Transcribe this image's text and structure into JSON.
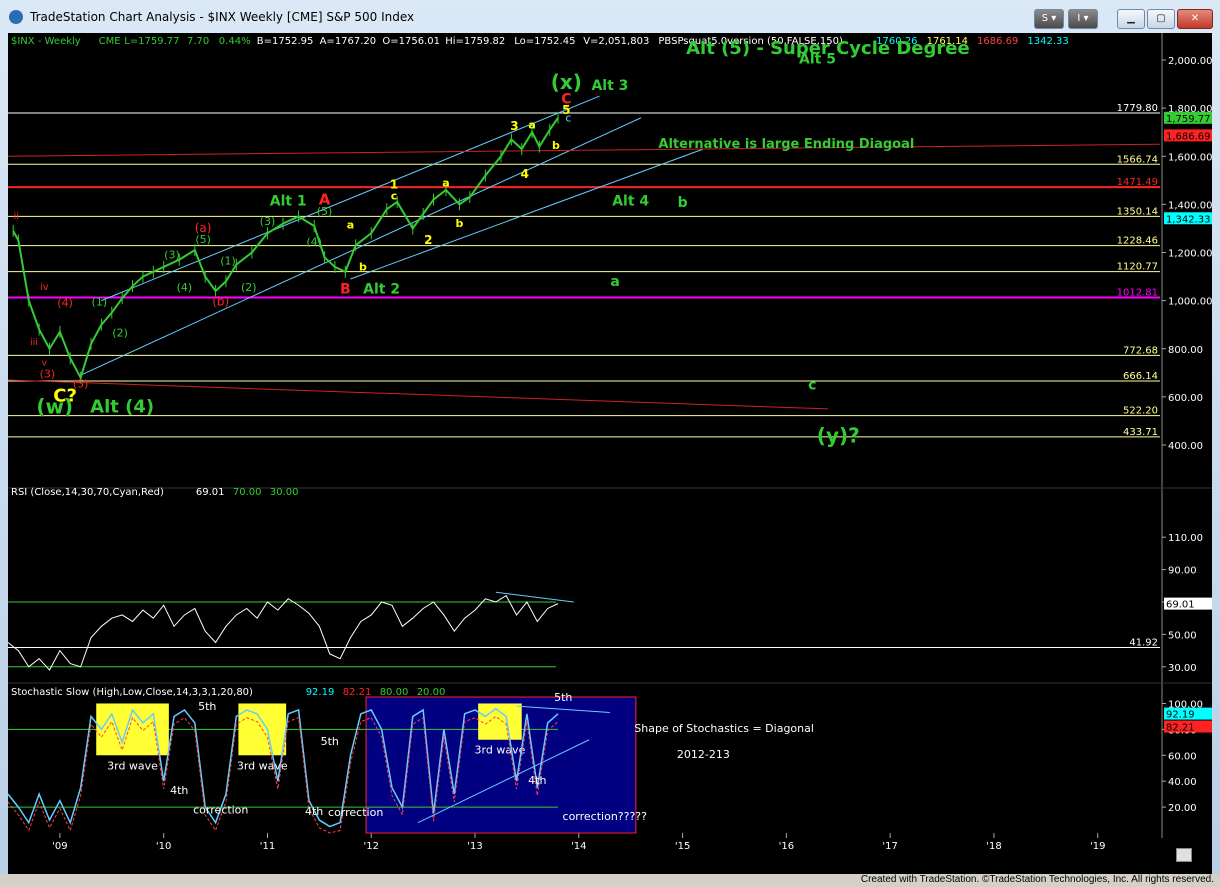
{
  "window": {
    "title": "TradeStation Chart Analysis - $INX Weekly [CME] S&P 500 Index",
    "buttons": {
      "s_label": "S",
      "i_label": "I"
    }
  },
  "header": {
    "symbol": "$INX - Weekly",
    "exchange": "CME",
    "last": "L=1759.77",
    "change": "7.70",
    "pct": "0.44%",
    "bid": "B=1752.95",
    "ask": "A=1767.20",
    "open": "O=1756.01",
    "hi": "Hi=1759.82",
    "lo": "Lo=1752.45",
    "vol": "V=2,051,803",
    "study": "PBSPsquat5.0version (50,FALSE,150)",
    "study_vals": [
      "1760.26",
      "1761.14",
      "1686.69",
      "1342.33"
    ],
    "study_colors": [
      "#00ffff",
      "#ffff66",
      "#ff4040",
      "#00ffff"
    ]
  },
  "colors": {
    "up": "#33cc33",
    "level_yellow": "#ffff99",
    "level_red": "#ff2222",
    "level_magenta": "#ff00ff",
    "trend_cyan": "#66ccff",
    "count_green": "#33cc33",
    "count_red": "#ff2222",
    "count_yellow": "#ffff00",
    "stoch_panel": "#000080",
    "stoch_box": "#ffff33"
  },
  "chart_data": {
    "type": "line",
    "xlabel": "",
    "ylabel": "",
    "x_ticks": [
      "'09",
      "'10",
      "'11",
      "'12",
      "'13",
      "'14",
      "'15",
      "'16",
      "'17",
      "'18",
      "'19"
    ],
    "price_ticks": [
      "2,000.00",
      "1,800.00",
      "1,600.00",
      "1,400.00",
      "1,200.00",
      "1,000.00",
      "800.00",
      "600.00",
      "400.00"
    ],
    "ylim": [
      350,
      2150
    ],
    "price_series": {
      "name": "$INX",
      "x": [
        2008.55,
        2008.6,
        2008.7,
        2008.8,
        2008.9,
        2009.0,
        2009.1,
        2009.2,
        2009.3,
        2009.4,
        2009.5,
        2009.6,
        2009.7,
        2009.8,
        2009.9,
        2010.0,
        2010.15,
        2010.3,
        2010.4,
        2010.5,
        2010.6,
        2010.7,
        2010.85,
        2011.0,
        2011.15,
        2011.3,
        2011.45,
        2011.55,
        2011.65,
        2011.75,
        2011.85,
        2012.0,
        2012.15,
        2012.25,
        2012.4,
        2012.5,
        2012.6,
        2012.72,
        2012.85,
        2012.95,
        2013.1,
        2013.25,
        2013.35,
        2013.45,
        2013.55,
        2013.62,
        2013.72,
        2013.8
      ],
      "y": [
        1290,
        1250,
        1000,
        880,
        800,
        870,
        760,
        680,
        820,
        900,
        950,
        1010,
        1060,
        1100,
        1120,
        1140,
        1170,
        1210,
        1100,
        1040,
        1080,
        1150,
        1200,
        1280,
        1320,
        1350,
        1310,
        1180,
        1140,
        1120,
        1230,
        1280,
        1380,
        1410,
        1300,
        1360,
        1420,
        1460,
        1400,
        1430,
        1520,
        1600,
        1670,
        1630,
        1700,
        1640,
        1710,
        1760
      ]
    },
    "levels": [
      {
        "label": "1779.80",
        "value": 1779.8,
        "color": "#ffffff"
      },
      {
        "label": "1566.74",
        "value": 1566.74,
        "color": "#ffff99"
      },
      {
        "label": "1471.49",
        "value": 1471.49,
        "color": "#ff2222"
      },
      {
        "label": "1350.14",
        "value": 1350.14,
        "color": "#ffff99"
      },
      {
        "label": "1228.46",
        "value": 1228.46,
        "color": "#ffff99"
      },
      {
        "label": "1120.77",
        "value": 1120.77,
        "color": "#ffff99"
      },
      {
        "label": "1012.81",
        "value": 1012.81,
        "color": "#ff00ff"
      },
      {
        "label": "772.68",
        "value": 772.68,
        "color": "#ffff99"
      },
      {
        "label": "666.14",
        "value": 666.14,
        "color": "#ffff99"
      },
      {
        "label": "522.20",
        "value": 522.2,
        "color": "#ffff99"
      },
      {
        "label": "433.71",
        "value": 433.71,
        "color": "#ffff99"
      }
    ],
    "price_tags": [
      {
        "label": "1,759.77",
        "value": 1759.77,
        "bg": "#33cc33",
        "fg": "#000000"
      },
      {
        "label": "1,686.69",
        "value": 1686.69,
        "bg": "#ff2222",
        "fg": "#000000"
      },
      {
        "label": "1,342.33",
        "value": 1342.33,
        "bg": "#00ffff",
        "fg": "#000000"
      }
    ],
    "trendlines": [
      {
        "x1": 2009.2,
        "y1": 690,
        "x2": 2014.6,
        "y2": 1760,
        "color": "#66ccff"
      },
      {
        "x1": 2009.4,
        "y1": 1000,
        "x2": 2014.2,
        "y2": 1850,
        "color": "#66ccff"
      },
      {
        "x1": 2011.8,
        "y1": 1090,
        "x2": 2015.2,
        "y2": 1630,
        "color": "#66ccff"
      },
      {
        "x1": 2008.5,
        "y1": 670,
        "x2": 2016.4,
        "y2": 550,
        "color": "#cc2222"
      },
      {
        "x1": 2008.5,
        "y1": 1600,
        "x2": 2019.6,
        "y2": 1650,
        "color": "#cc2222"
      }
    ],
    "annotations": [
      {
        "text": "(x)",
        "x": 2013.88,
        "y": 1880,
        "color": "#33cc33",
        "size": 20,
        "bold": true
      },
      {
        "text": "Alt 3",
        "x": 2014.3,
        "y": 1875,
        "color": "#33cc33",
        "size": 14,
        "bold": true
      },
      {
        "text": "C",
        "x": 2013.88,
        "y": 1820,
        "color": "#ff2222",
        "size": 14,
        "bold": true
      },
      {
        "text": "5",
        "x": 2013.88,
        "y": 1775,
        "color": "#ffff00",
        "size": 12,
        "bold": true
      },
      {
        "text": "c",
        "x": 2013.9,
        "y": 1745,
        "color": "#66ccff",
        "size": 11,
        "bold": false
      },
      {
        "text": "Alt (5) - Super Cycle Degree",
        "x": 2016.4,
        "y": 2025,
        "color": "#33cc33",
        "size": 18,
        "bold": true
      },
      {
        "text": "Alt 5",
        "x": 2016.3,
        "y": 1985,
        "color": "#33cc33",
        "size": 14,
        "bold": true
      },
      {
        "text": "Alternative is large Ending Diagoal",
        "x": 2016.0,
        "y": 1635,
        "color": "#33cc33",
        "size": 13,
        "bold": true
      },
      {
        "text": "3",
        "x": 2013.38,
        "y": 1710,
        "color": "#ffff00",
        "size": 12,
        "bold": true
      },
      {
        "text": "a",
        "x": 2013.55,
        "y": 1715,
        "color": "#ffff00",
        "size": 11,
        "bold": true
      },
      {
        "text": "b",
        "x": 2013.78,
        "y": 1630,
        "color": "#ffff00",
        "size": 11,
        "bold": true
      },
      {
        "text": "4",
        "x": 2013.48,
        "y": 1510,
        "color": "#ffff00",
        "size": 12,
        "bold": true
      },
      {
        "text": "Alt 4",
        "x": 2014.5,
        "y": 1395,
        "color": "#33cc33",
        "size": 14,
        "bold": true
      },
      {
        "text": "b",
        "x": 2015.0,
        "y": 1390,
        "color": "#33cc33",
        "size": 14,
        "bold": true
      },
      {
        "text": "a",
        "x": 2014.35,
        "y": 1060,
        "color": "#33cc33",
        "size": 14,
        "bold": true
      },
      {
        "text": "c",
        "x": 2016.25,
        "y": 630,
        "color": "#33cc33",
        "size": 14,
        "bold": true
      },
      {
        "text": "(y)?",
        "x": 2016.5,
        "y": 410,
        "color": "#33cc33",
        "size": 20,
        "bold": true
      },
      {
        "text": "Alt 1",
        "x": 2011.2,
        "y": 1395,
        "color": "#33cc33",
        "size": 14,
        "bold": true
      },
      {
        "text": "A",
        "x": 2011.55,
        "y": 1400,
        "color": "#ff2222",
        "size": 15,
        "bold": true
      },
      {
        "text": "(5)",
        "x": 2011.55,
        "y": 1355,
        "color": "#33cc33",
        "size": 11,
        "bold": false
      },
      {
        "text": "(4)",
        "x": 2011.45,
        "y": 1230,
        "color": "#33cc33",
        "size": 11,
        "bold": false
      },
      {
        "text": "(3)",
        "x": 2011.0,
        "y": 1315,
        "color": "#33cc33",
        "size": 11,
        "bold": false
      },
      {
        "text": "1",
        "x": 2012.22,
        "y": 1465,
        "color": "#ffff00",
        "size": 12,
        "bold": true
      },
      {
        "text": "c",
        "x": 2012.22,
        "y": 1420,
        "color": "#ffff00",
        "size": 11,
        "bold": true
      },
      {
        "text": "2",
        "x": 2012.55,
        "y": 1235,
        "color": "#ffff00",
        "size": 12,
        "bold": true
      },
      {
        "text": "a",
        "x": 2012.72,
        "y": 1475,
        "color": "#ffff00",
        "size": 11,
        "bold": true
      },
      {
        "text": "b",
        "x": 2012.85,
        "y": 1305,
        "color": "#ffff00",
        "size": 11,
        "bold": true
      },
      {
        "text": "a",
        "x": 2011.8,
        "y": 1300,
        "color": "#ffff00",
        "size": 11,
        "bold": true
      },
      {
        "text": "b",
        "x": 2011.92,
        "y": 1125,
        "color": "#ffff00",
        "size": 11,
        "bold": true
      },
      {
        "text": "B",
        "x": 2011.75,
        "y": 1030,
        "color": "#ff2222",
        "size": 14,
        "bold": true
      },
      {
        "text": "Alt 2",
        "x": 2012.1,
        "y": 1030,
        "color": "#33cc33",
        "size": 14,
        "bold": true
      },
      {
        "text": "(a)",
        "x": 2010.38,
        "y": 1285,
        "color": "#ff2222",
        "size": 12,
        "bold": false
      },
      {
        "text": "(5)",
        "x": 2010.38,
        "y": 1240,
        "color": "#33cc33",
        "size": 11,
        "bold": false
      },
      {
        "text": "(3)",
        "x": 2010.08,
        "y": 1175,
        "color": "#33cc33",
        "size": 11,
        "bold": false
      },
      {
        "text": "(1)",
        "x": 2010.62,
        "y": 1150,
        "color": "#33cc33",
        "size": 11,
        "bold": false
      },
      {
        "text": "(4)",
        "x": 2010.2,
        "y": 1040,
        "color": "#33cc33",
        "size": 11,
        "bold": false
      },
      {
        "text": "(2)",
        "x": 2010.82,
        "y": 1040,
        "color": "#33cc33",
        "size": 11,
        "bold": false
      },
      {
        "text": "(b)",
        "x": 2010.55,
        "y": 980,
        "color": "#ff2222",
        "size": 12,
        "bold": false
      },
      {
        "text": "(1)",
        "x": 2009.38,
        "y": 980,
        "color": "#33cc33",
        "size": 11,
        "bold": false
      },
      {
        "text": "(2)",
        "x": 2009.58,
        "y": 850,
        "color": "#33cc33",
        "size": 11,
        "bold": false
      },
      {
        "text": "(4)",
        "x": 2009.05,
        "y": 975,
        "color": "#ff2222",
        "size": 11,
        "bold": false
      },
      {
        "text": "iv",
        "x": 2008.85,
        "y": 1045,
        "color": "#ff2222",
        "size": 10,
        "bold": false
      },
      {
        "text": "ii",
        "x": 2008.58,
        "y": 1340,
        "color": "#ff2222",
        "size": 10,
        "bold": false
      },
      {
        "text": "iii",
        "x": 2008.75,
        "y": 815,
        "color": "#ff2222",
        "size": 9,
        "bold": false
      },
      {
        "text": "v",
        "x": 2008.85,
        "y": 730,
        "color": "#ff2222",
        "size": 9,
        "bold": false
      },
      {
        "text": "(3)",
        "x": 2008.88,
        "y": 680,
        "color": "#ff2222",
        "size": 11,
        "bold": false
      },
      {
        "text": "(5)",
        "x": 2009.2,
        "y": 640,
        "color": "#ff2222",
        "size": 11,
        "bold": false
      },
      {
        "text": "C?",
        "x": 2009.05,
        "y": 580,
        "color": "#ffff00",
        "size": 18,
        "bold": true
      },
      {
        "text": "(w)",
        "x": 2008.95,
        "y": 530,
        "color": "#33cc33",
        "size": 20,
        "bold": true
      },
      {
        "text": "Alt (4)",
        "x": 2009.6,
        "y": 535,
        "color": "#33cc33",
        "size": 18,
        "bold": true
      }
    ],
    "rsi": {
      "title": "RSI (Close,14,30,70,Cyan,Red)",
      "values_labels": [
        "69.01",
        "70.00",
        "30.00"
      ],
      "values_colors": [
        "#ffffff",
        "#33cc33",
        "#33cc33"
      ],
      "ticks": [
        "110.00",
        "90.00",
        "70.00",
        "50.00",
        "30.00"
      ],
      "ylim": [
        20,
        120
      ],
      "overbought": 70,
      "oversold": 30,
      "extra_level": 41.92,
      "extra_label": "41.92",
      "last_label": "69.01",
      "last_value": 69.01,
      "x": [
        2008.5,
        2008.6,
        2008.7,
        2008.8,
        2008.9,
        2009.0,
        2009.1,
        2009.2,
        2009.3,
        2009.4,
        2009.5,
        2009.6,
        2009.7,
        2009.8,
        2009.9,
        2010.0,
        2010.1,
        2010.2,
        2010.3,
        2010.4,
        2010.5,
        2010.6,
        2010.7,
        2010.8,
        2010.9,
        2011.0,
        2011.1,
        2011.2,
        2011.3,
        2011.4,
        2011.5,
        2011.6,
        2011.7,
        2011.8,
        2011.9,
        2012.0,
        2012.1,
        2012.2,
        2012.3,
        2012.4,
        2012.5,
        2012.6,
        2012.7,
        2012.8,
        2012.9,
        2013.0,
        2013.1,
        2013.2,
        2013.3,
        2013.4,
        2013.5,
        2013.6,
        2013.7,
        2013.8
      ],
      "y": [
        45,
        40,
        30,
        35,
        28,
        40,
        32,
        30,
        48,
        55,
        60,
        62,
        58,
        65,
        60,
        68,
        55,
        62,
        66,
        52,
        45,
        55,
        62,
        66,
        60,
        70,
        65,
        72,
        68,
        63,
        55,
        38,
        35,
        48,
        58,
        62,
        70,
        68,
        55,
        60,
        66,
        70,
        62,
        52,
        60,
        65,
        72,
        70,
        74,
        62,
        70,
        58,
        66,
        69
      ]
    },
    "stochastic": {
      "title": "Stochastic Slow (High,Low,Close,14,3,3,1,20,80)",
      "values_labels": [
        "92.19",
        "82.21",
        "80.00",
        "20.00"
      ],
      "values_colors": [
        "#00ffff",
        "#ff2222",
        "#33cc33",
        "#33cc33"
      ],
      "ticks": [
        "100.00",
        "80.00",
        "60.00",
        "40.00",
        "20.00"
      ],
      "ylim": [
        0,
        105
      ],
      "tags": [
        {
          "label": "92.19",
          "value": 92.19,
          "bg": "#00ffff"
        },
        {
          "label": "82.21",
          "value": 82.21,
          "bg": "#ff2222"
        }
      ],
      "k_x": [
        2008.5,
        2008.6,
        2008.7,
        2008.8,
        2008.9,
        2009.0,
        2009.1,
        2009.2,
        2009.3,
        2009.4,
        2009.5,
        2009.6,
        2009.7,
        2009.8,
        2009.9,
        2010.0,
        2010.1,
        2010.2,
        2010.3,
        2010.4,
        2010.5,
        2010.6,
        2010.7,
        2010.8,
        2010.9,
        2011.0,
        2011.1,
        2011.2,
        2011.3,
        2011.4,
        2011.5,
        2011.6,
        2011.7,
        2011.8,
        2011.9,
        2012.0,
        2012.1,
        2012.2,
        2012.3,
        2012.4,
        2012.5,
        2012.6,
        2012.7,
        2012.8,
        2012.9,
        2013.0,
        2013.1,
        2013.2,
        2013.3,
        2013.4,
        2013.5,
        2013.6,
        2013.7,
        2013.8
      ],
      "k_y": [
        30,
        20,
        8,
        30,
        10,
        25,
        8,
        35,
        90,
        80,
        92,
        70,
        95,
        85,
        92,
        40,
        90,
        95,
        85,
        20,
        8,
        30,
        90,
        95,
        92,
        80,
        40,
        92,
        95,
        25,
        10,
        5,
        8,
        60,
        92,
        95,
        80,
        35,
        20,
        90,
        95,
        15,
        80,
        30,
        92,
        95,
        90,
        96,
        90,
        40,
        92,
        35,
        85,
        92
      ],
      "boxes": [
        {
          "x1": 2009.35,
          "x2": 2010.05,
          "y1": 60,
          "y2": 100,
          "label": "3rd wave"
        },
        {
          "x1": 2010.72,
          "x2": 2011.18,
          "y1": 60,
          "y2": 100,
          "label": "3rd wave"
        },
        {
          "x1": 2013.03,
          "x2": 2013.45,
          "y1": 72,
          "y2": 100,
          "label": "3rd wave"
        }
      ],
      "panel_box": {
        "x1": 2011.95,
        "x2": 2014.55,
        "y1": 0,
        "y2": 105
      },
      "notes": [
        {
          "text": "5th",
          "x": 2010.42,
          "y": 95
        },
        {
          "text": "4th",
          "x": 2010.15,
          "y": 30
        },
        {
          "text": "correction",
          "x": 2010.55,
          "y": 15
        },
        {
          "text": "5th",
          "x": 2011.6,
          "y": 68
        },
        {
          "text": "4th",
          "x": 2011.45,
          "y": 14
        },
        {
          "text": "correction",
          "x": 2011.85,
          "y": 13
        },
        {
          "text": "5th",
          "x": 2013.85,
          "y": 102
        },
        {
          "text": "4th",
          "x": 2013.6,
          "y": 38
        },
        {
          "text": "Shape of Stochastics = Diagonal",
          "x": 2015.4,
          "y": 78
        },
        {
          "text": "2012-213",
          "x": 2015.2,
          "y": 58
        },
        {
          "text": "correction?????",
          "x": 2014.25,
          "y": 10
        }
      ]
    }
  },
  "footer": "Created with TradeStation. ©TradeStation Technologies, Inc. All rights reserved."
}
